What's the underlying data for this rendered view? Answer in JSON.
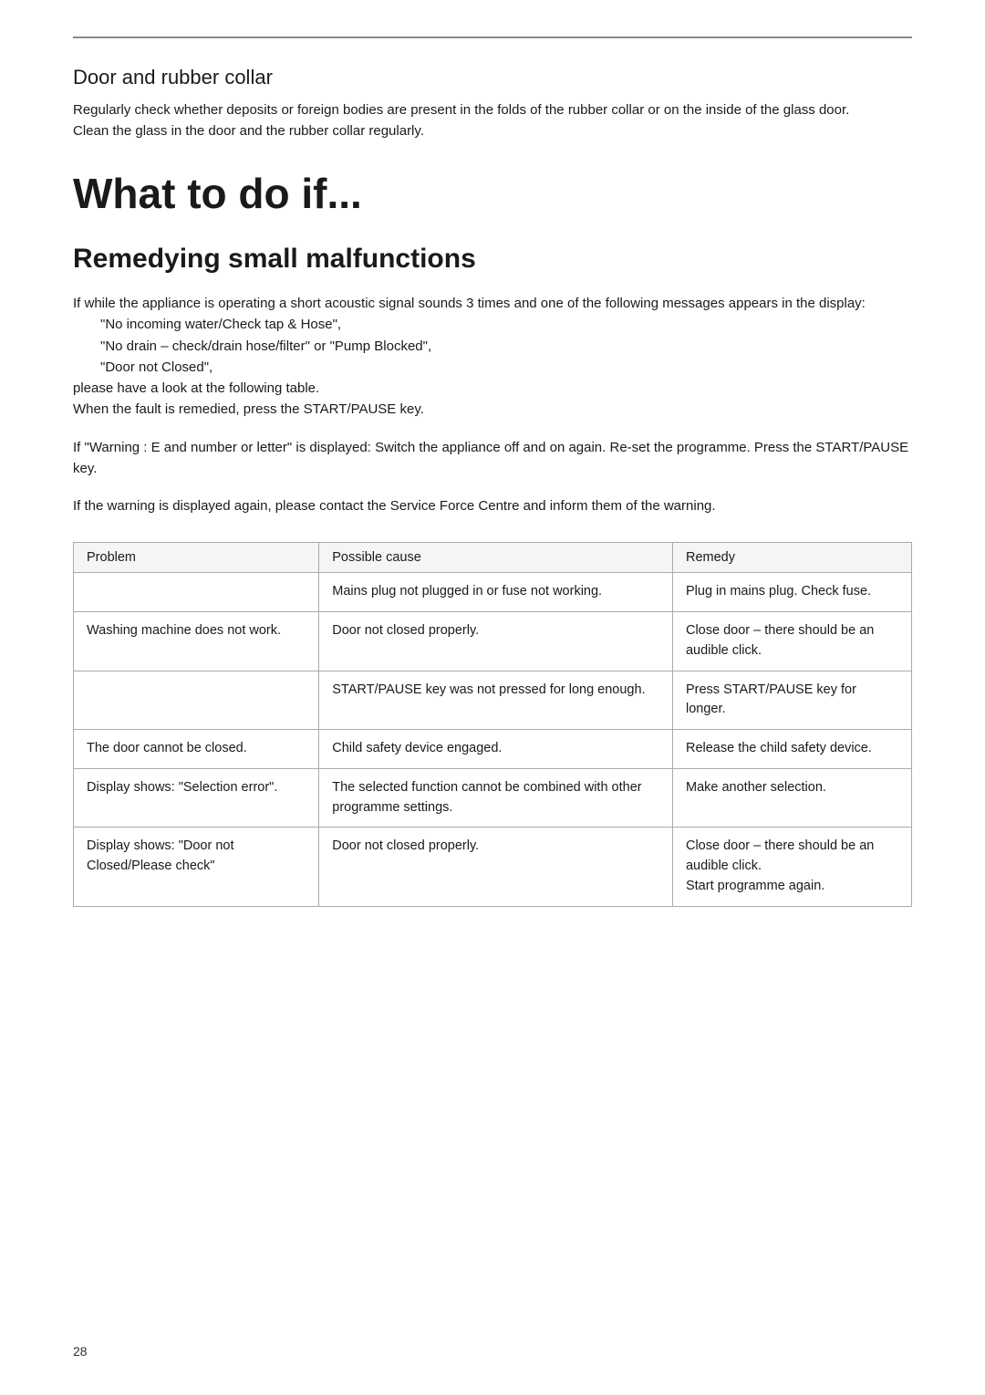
{
  "top_border": true,
  "door_collar": {
    "title": "Door and rubber collar",
    "body": "Regularly check whether deposits or foreign bodies are present in the folds of the rubber collar or on the inside of the glass door.\nClean the glass in the door and the rubber collar regularly."
  },
  "main_title": "What to do if...",
  "section_title": "Remedying small malfunctions",
  "intro_paragraphs": [
    {
      "text": "If while the appliance is operating a short acoustic signal sounds 3 times and one of the following messages appears in the display:",
      "indented_lines": [
        "\"No incoming water/Check tap & Hose\",",
        "\"No drain – check/drain hose/filter\" or \"Pump Blocked\",",
        "\"Door not Closed\","
      ],
      "continuation": "please have a look at the following table.\nWhen the fault is remedied, press the START/PAUSE key."
    },
    {
      "text": "If \"Warning : E and number or letter\" is displayed: Switch the appliance off and on again. Re-set the programme. Press the START/PAUSE key."
    },
    {
      "text": "If the warning is displayed again, please contact the Service Force Centre and inform them of the warning."
    }
  ],
  "table": {
    "headers": [
      "Problem",
      "Possible cause",
      "Remedy"
    ],
    "rows": [
      {
        "problem": "",
        "cause": "Mains plug not plugged in or fuse not working.",
        "remedy": "Plug in mains plug. Check fuse."
      },
      {
        "problem": "Washing machine does not work.",
        "cause": "Door not closed properly.",
        "remedy": "Close door – there should be an audible click."
      },
      {
        "problem": "",
        "cause": "START/PAUSE key was not pressed for long enough.",
        "remedy": "Press START/PAUSE key for longer."
      },
      {
        "problem": "The door cannot be closed.",
        "cause": "Child safety device engaged.",
        "remedy": "Release the child safety device."
      },
      {
        "problem": "Display shows: \"Selection error\".",
        "cause": "The selected function cannot be combined with other programme settings.",
        "remedy": "Make another selection."
      },
      {
        "problem": "Display shows: \"Door not Closed/Please check\"",
        "cause": "Door not closed properly.",
        "remedy": "Close door – there should be an audible click.\nStart programme again."
      }
    ]
  },
  "page_number": "28"
}
